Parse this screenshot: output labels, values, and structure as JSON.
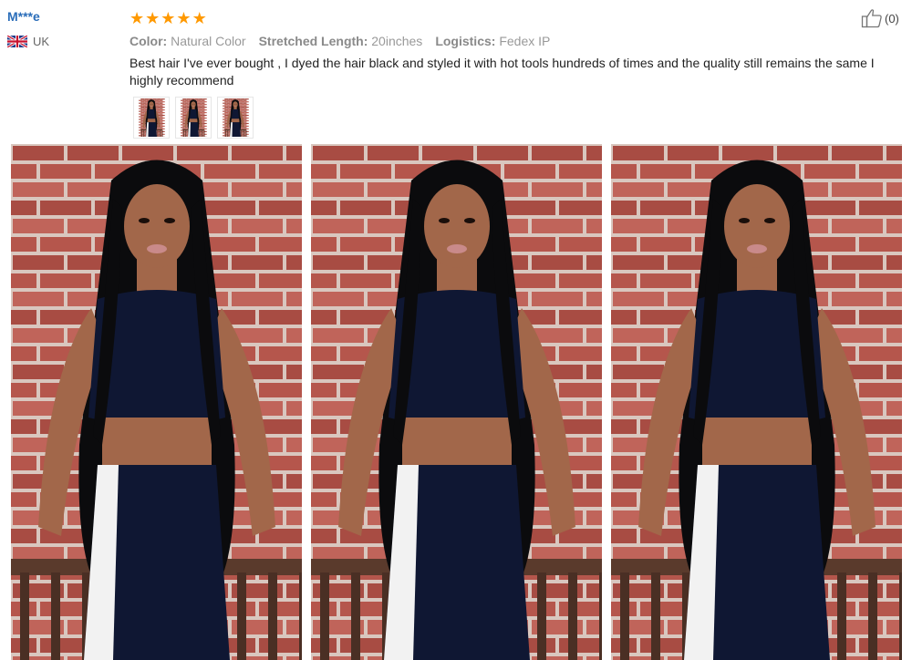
{
  "review": {
    "reviewer": "M***e",
    "country": "UK",
    "rating": 5,
    "attributes": [
      {
        "label": "Color:",
        "value": "Natural Color"
      },
      {
        "label": "Stretched Length:",
        "value": "20inches"
      },
      {
        "label": "Logistics:",
        "value": "Fedex IP"
      }
    ],
    "text": "Best hair I've ever bought , I dyed the hair black and styled it with hot tools hundreds of times and the quality still remains the same I highly recommend",
    "likes": "(0)"
  },
  "colors": {
    "name": "#2a6db9",
    "star": "#ff9900",
    "brick": "#b5564c",
    "mortar": "#d9c7bf",
    "top": "#0f1733",
    "hair": "#0b0b0d",
    "skin": "#a2674a"
  },
  "icons": {
    "flag": "uk-flag-icon",
    "star": "star-icon",
    "like": "thumbs-up-icon"
  }
}
